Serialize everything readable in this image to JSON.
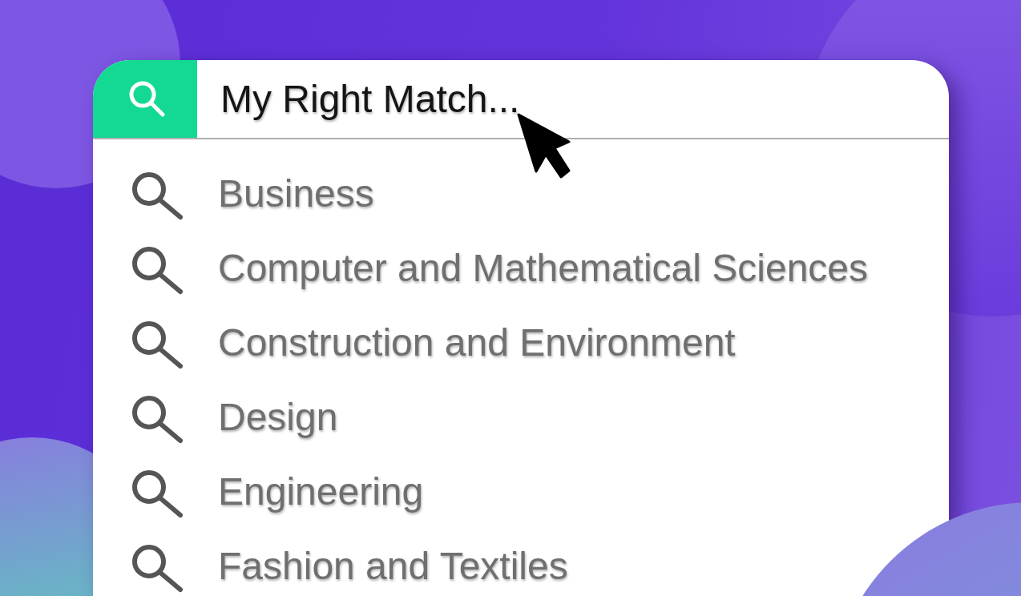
{
  "search": {
    "value": "My Right Match..."
  },
  "suggestions": [
    {
      "label": "Business"
    },
    {
      "label": "Computer and Mathematical Sciences"
    },
    {
      "label": "Construction and Environment"
    },
    {
      "label": "Design"
    },
    {
      "label": "Engineering"
    },
    {
      "label": "Fashion and Textiles"
    }
  ]
}
